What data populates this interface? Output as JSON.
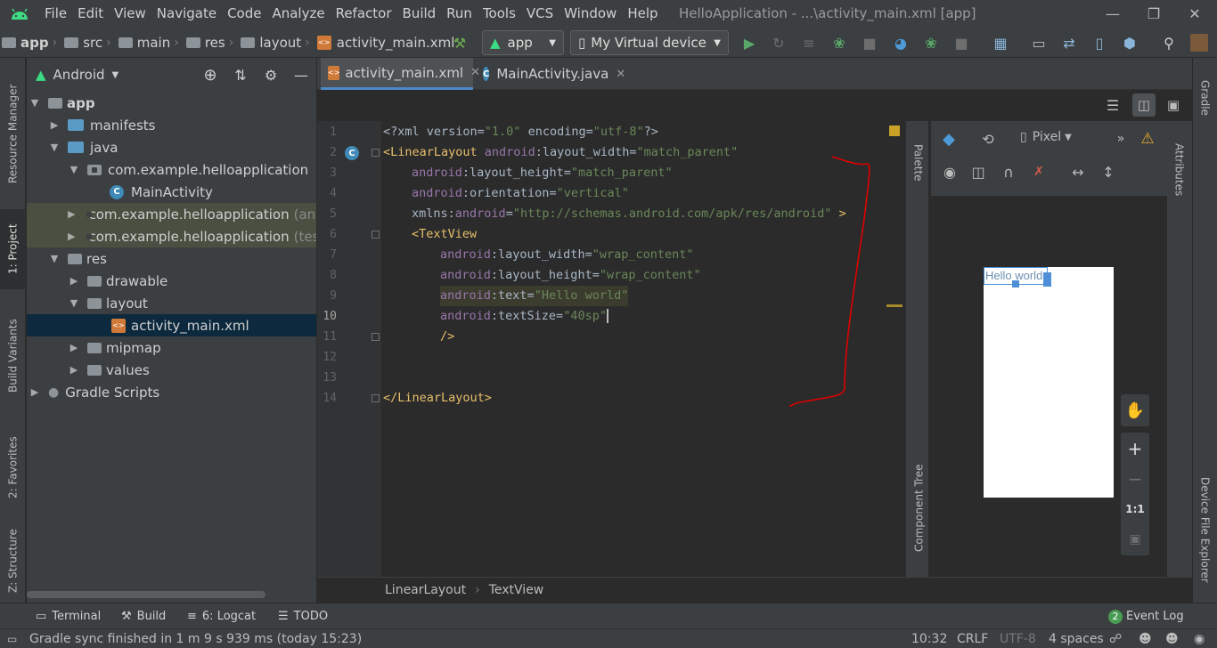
{
  "menubar": {
    "items": [
      "File",
      "Edit",
      "View",
      "Navigate",
      "Code",
      "Analyze",
      "Refactor",
      "Build",
      "Run",
      "Tools",
      "VCS",
      "Window",
      "Help"
    ],
    "title": "HelloApplication - ...\\activity_main.xml [app]"
  },
  "navbar": {
    "crumbs": [
      "app",
      "src",
      "main",
      "res",
      "layout",
      "activity_main.xml"
    ],
    "run_config": "app",
    "device": "My Virtual device"
  },
  "left_stripe": {
    "resource_manager": "Resource Manager",
    "project": "1: Project",
    "build_variants": "Build Variants",
    "favorites": "2: Favorites",
    "structure": "Z: Structure"
  },
  "project": {
    "view_mode": "Android",
    "tree": [
      {
        "label": "app",
        "bold": true
      },
      {
        "label": "manifests"
      },
      {
        "label": "java"
      },
      {
        "label": "com.example.helloapplication"
      },
      {
        "label": "MainActivity"
      },
      {
        "label": "com.example.helloapplication",
        "suffix": "(anc"
      },
      {
        "label": "com.example.helloapplication",
        "suffix": "(tes"
      },
      {
        "label": "res"
      },
      {
        "label": "drawable"
      },
      {
        "label": "layout"
      },
      {
        "label": "activity_main.xml"
      },
      {
        "label": "mipmap"
      },
      {
        "label": "values"
      },
      {
        "label": "Gradle Scripts"
      }
    ]
  },
  "editor": {
    "tabs": [
      "activity_main.xml",
      "MainActivity.java"
    ],
    "line_numbers": [
      "1",
      "2",
      "3",
      "4",
      "5",
      "6",
      "7",
      "8",
      "9",
      "10",
      "11",
      "12",
      "13",
      "14"
    ],
    "lines": {
      "l1_a": "<?xml version=",
      "l1_b": "\"1.0\"",
      "l1_c": " encoding=",
      "l1_d": "\"utf-8\"",
      "l1_e": "?>",
      "l2_a": "<LinearLayout ",
      "l2_b": "android",
      "l2_c": ":layout_width=",
      "l2_d": "\"match_parent\"",
      "l3_a": "android",
      "l3_b": ":layout_height=",
      "l3_c": "\"match_parent\"",
      "l4_a": "android",
      "l4_b": ":orientation=",
      "l4_c": "\"vertical\"",
      "l5_a": "xmlns:",
      "l5_b": "android",
      "l5_c": "=",
      "l5_d": "\"http://schemas.android.com/apk/res/android\"",
      "l5_e": " >",
      "l6_a": "<TextView",
      "l7_a": "android",
      "l7_b": ":layout_width=",
      "l7_c": "\"wrap_content\"",
      "l8_a": "android",
      "l8_b": ":layout_height=",
      "l8_c": "\"wrap_content\"",
      "l9_a": "android",
      "l9_b": ":text=",
      "l9_c": "\"Hello world\"",
      "l10_a": "android",
      "l10_b": ":textSize=",
      "l10_c": "\"40sp\"",
      "l11_a": "/>",
      "l14_a": "</LinearLayout>"
    },
    "breadcrumb": [
      "LinearLayout",
      "TextView"
    ]
  },
  "design": {
    "device_label": "Pixel",
    "preview_text": "Hello world",
    "zoom_ratio": "1:1",
    "palette": "Palette",
    "component_tree": "Component Tree",
    "attributes": "Attributes"
  },
  "right_stripe": {
    "gradle": "Gradle",
    "device_file_explorer": "Device File Explorer"
  },
  "toolwindows": {
    "terminal": "Terminal",
    "build": "Build",
    "logcat": "6: Logcat",
    "todo": "TODO",
    "event_badge": "2",
    "event_log": "Event Log"
  },
  "status": {
    "message": "Gradle sync finished in 1 m 9 s 939 ms (today 15:23)",
    "position": "10:32",
    "line_sep": "CRLF",
    "encoding": "UTF-8",
    "indent": "4 spaces"
  },
  "colors": {
    "annotation": "#e00000",
    "accent": "#4a88c7"
  }
}
